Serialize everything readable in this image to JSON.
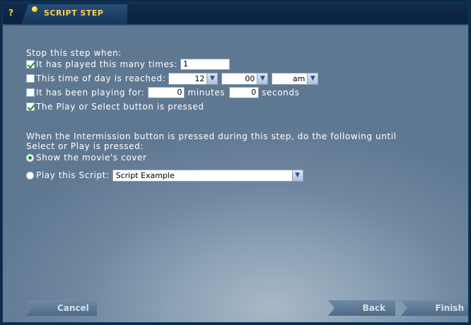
{
  "window": {
    "help_label": "?",
    "tab_title": "SCRIPT STEP"
  },
  "stop_section": {
    "heading": "Stop this step when:",
    "played_times": {
      "label": "It has played this many times:",
      "checked": true,
      "value": "1"
    },
    "time_of_day": {
      "label": "This time of day is reached:",
      "checked": false,
      "hour": "12",
      "minute": "00",
      "ampm": "am"
    },
    "playing_for": {
      "label": "It has been playing for:",
      "checked": false,
      "minutes_value": "0",
      "minutes_label": "minutes",
      "seconds_value": "0",
      "seconds_label": "seconds"
    },
    "button_pressed": {
      "label": "The Play or Select button is pressed",
      "checked": true
    }
  },
  "intermission_section": {
    "heading_line1": "When the Intermission button is pressed during this step, do the following until",
    "heading_line2": "Select or Play is pressed:",
    "option_cover": {
      "label": "Show the movie's cover",
      "selected": true
    },
    "option_script": {
      "label": "Play this Script:",
      "selected": false,
      "script_value": "Script Example"
    }
  },
  "buttons": {
    "cancel": "Cancel",
    "back": "Back",
    "finish": "Finish"
  },
  "colors": {
    "accent": "#ffd24a",
    "check": "#1f8a1a",
    "titlebar": "#0b2140"
  }
}
